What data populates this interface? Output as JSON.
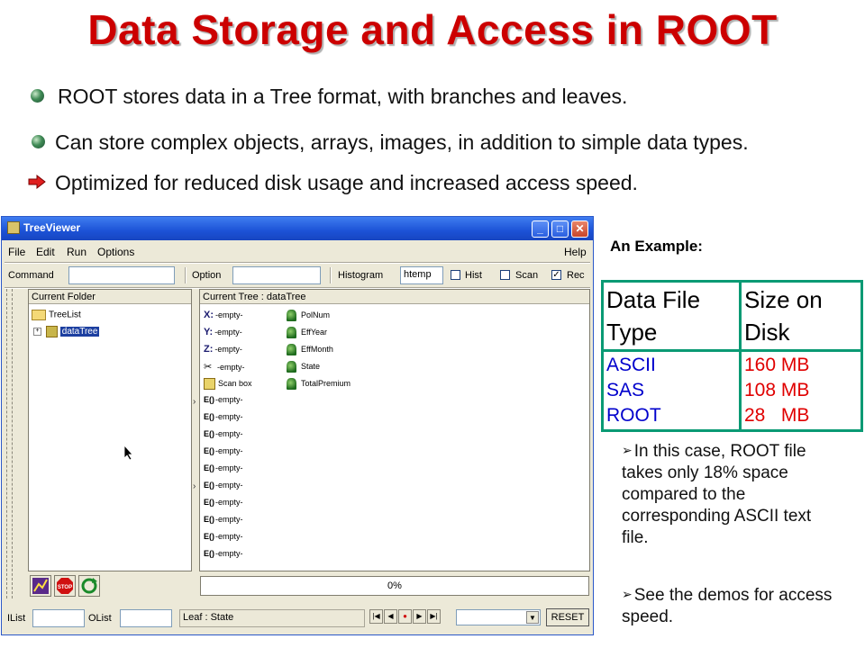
{
  "slide": {
    "title": "Data Storage and Access in ROOT",
    "bullets": [
      {
        "icon": "green-ball-icon",
        "text": "ROOT stores data in a Tree format, with branches and leaves."
      },
      {
        "icon": "green-ball-icon",
        "text": "Can store complex objects, arrays,  images, in addition to simple data types."
      },
      {
        "icon": "red-arrow-icon",
        "text": "Optimized for reduced disk usage and increased access speed."
      }
    ]
  },
  "window": {
    "title": "TreeViewer",
    "menu": {
      "file": "File",
      "edit": "Edit",
      "run": "Run",
      "options": "Options",
      "help": "Help"
    },
    "toolbar": {
      "command_label": "Command",
      "command_value": "",
      "option_label": "Option",
      "option_value": "",
      "histogram_label": "Histogram",
      "histogram_value": "htemp",
      "hist_label": "Hist",
      "hist_checked": false,
      "scan_label": "Scan",
      "scan_checked": false,
      "rec_label": "Rec",
      "rec_checked": true
    },
    "folder_panel": {
      "header": "Current Folder",
      "items": [
        "TreeList",
        "dataTree"
      ]
    },
    "tree_panel": {
      "header": "Current Tree : dataTree",
      "axes": [
        {
          "label": "X:",
          "value": "-empty-"
        },
        {
          "label": "Y:",
          "value": "-empty-"
        },
        {
          "label": "Z:",
          "value": "-empty-"
        },
        {
          "label": "✂",
          "value": "-empty-"
        }
      ],
      "scan_box": "Scan box",
      "expressions": [
        "-empty-",
        "-empty-",
        "-empty-",
        "-empty-",
        "-empty-",
        "-empty-",
        "-empty-",
        "-empty-",
        "-empty-",
        "-empty-"
      ],
      "leaves": [
        "PolNum",
        "EffYear",
        "EffMonth",
        "State",
        "TotalPremium"
      ]
    },
    "progress": "0%",
    "statusbar": {
      "ilist_label": "IList",
      "ilist_value": "",
      "olist_label": "OList",
      "olist_value": "",
      "leaf_status": "Leaf : State",
      "reset_label": "RESET"
    }
  },
  "example": {
    "heading": "An Example:",
    "table": {
      "headers": [
        "Data File Type",
        "Size on Disk"
      ],
      "types": [
        "ASCII",
        "SAS",
        "ROOT"
      ],
      "sizes": [
        "160 MB",
        "108 MB",
        "28   MB"
      ],
      "colors": {
        "type": "#0000cc",
        "size": "#e00000",
        "border": "#0a9a74"
      }
    },
    "notes": [
      "In this case, ROOT file takes only 18% space compared to the corresponding ASCII text file.",
      "See the demos for access speed."
    ]
  }
}
